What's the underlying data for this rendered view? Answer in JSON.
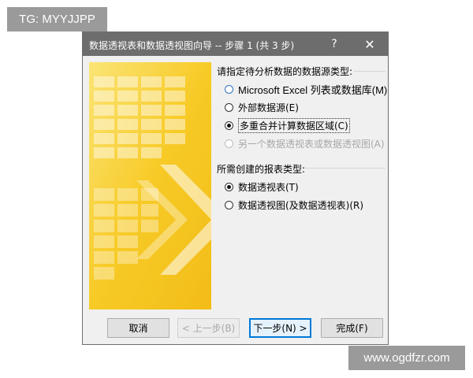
{
  "watermarks": {
    "top": "TG: MYYJJPP",
    "bottom": "www.ogdfzr.com"
  },
  "dialog": {
    "title": "数据透视表和数据透视图向导 -- 步骤 1 (共 3 步)",
    "help_glyph": "?",
    "close_glyph": "✕"
  },
  "data_source": {
    "heading": "请指定待分析数据的数据源类型:",
    "options": [
      {
        "label": "Microsoft Excel 列表或数据库(M)",
        "selected": false,
        "enabled": true
      },
      {
        "label": "外部数据源(E)",
        "selected": false,
        "enabled": true
      },
      {
        "label": "多重合并计算数据区域(C)",
        "selected": true,
        "enabled": true
      },
      {
        "label": "另一个数据透视表或数据透视图(A)",
        "selected": false,
        "enabled": false
      }
    ]
  },
  "report_type": {
    "heading": "所需创建的报表类型:",
    "options": [
      {
        "label": "数据透视表(T)",
        "selected": true,
        "enabled": true
      },
      {
        "label": "数据透视图(及数据透视表)(R)",
        "selected": false,
        "enabled": true
      }
    ]
  },
  "buttons": {
    "cancel": "取消",
    "back": "< 上一步(B)",
    "next": "下一步(N) >",
    "finish": "完成(F)"
  },
  "colors": {
    "titlebar": "#6d6d6d",
    "dialog_bg": "#f0f0f0",
    "art_yellow": "#f7c614",
    "accent_blue": "#0078d7"
  }
}
